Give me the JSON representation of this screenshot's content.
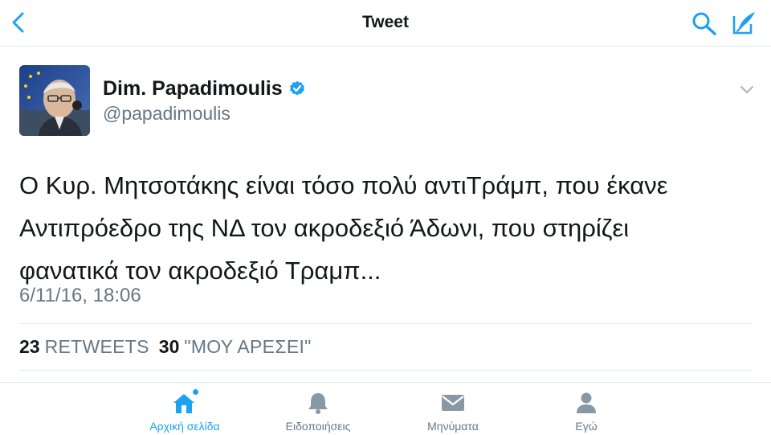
{
  "header": {
    "title": "Tweet",
    "back_icon": "chevron-left-icon",
    "search_icon": "search-icon",
    "compose_icon": "compose-icon"
  },
  "tweet": {
    "author_name": "Dim. Papadimoulis",
    "author_handle": "@papadimoulis",
    "verified": true,
    "text_lines": [
      "Ο Κυρ. Μητσοτάκης είναι τόσο πολύ αντιΤράμπ, που έκανε",
      "Αντιπρόεδρο της ΝΔ τον ακροδεξιό Άδωνι, που στηρίζει",
      "φανατικά τον ακροδεξιό Τραμπ..."
    ],
    "timestamp": "6/11/16, 18:06",
    "retweets_count": "23",
    "retweets_label": "RETWEETS",
    "likes_count": "30",
    "likes_label": "\"ΜΟΥ ΑΡΕΣΕΙ\""
  },
  "tabbar": {
    "items": [
      {
        "label": "Αρχική σελίδα",
        "icon": "home-icon",
        "active": true
      },
      {
        "label": "Ειδοποιήσεις",
        "icon": "bell-icon",
        "active": false
      },
      {
        "label": "Μηνύματα",
        "icon": "envelope-icon",
        "active": false
      },
      {
        "label": "Εγώ",
        "icon": "person-icon",
        "active": false
      }
    ]
  },
  "colors": {
    "accent": "#1da1f2",
    "text": "#14171a",
    "secondary": "#657786",
    "divider": "#e1e8ed",
    "icon_gray": "#8899a6"
  }
}
